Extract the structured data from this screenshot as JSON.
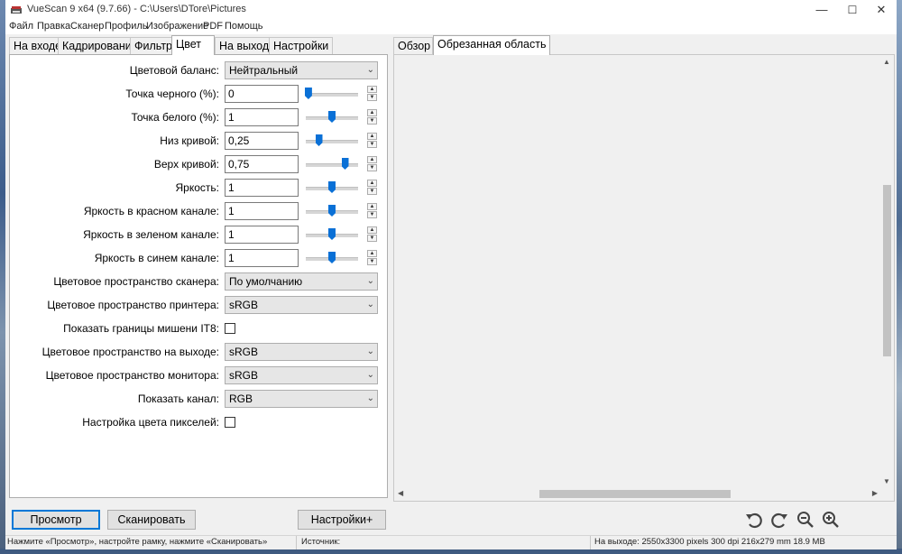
{
  "window": {
    "title": "VueScan 9 x64 (9.7.66) - C:\\Users\\DTore\\Pictures",
    "minimize_glyph": "—",
    "maximize_glyph": "☐",
    "close_glyph": "✕"
  },
  "menu": [
    "Файл",
    "Правка",
    "Сканер",
    "Профиль",
    "Изображение",
    "PDF",
    "Помощь"
  ],
  "left_tabs": {
    "items": [
      "На входе",
      "Кадрирование",
      "Фильтр",
      "Цвет",
      "На выходе",
      "Настройки"
    ],
    "active": "Цвет"
  },
  "color_settings": {
    "color_balance": {
      "label": "Цветовой баланс:",
      "value": "Нейтральный"
    },
    "black_point": {
      "label": "Точка черного (%):",
      "value": "0",
      "slider_pct": 0.05
    },
    "white_point": {
      "label": "Точка белого (%):",
      "value": "1",
      "slider_pct": 0.5
    },
    "curve_low": {
      "label": "Низ кривой:",
      "value": "0,25",
      "slider_pct": 0.25
    },
    "curve_high": {
      "label": "Верх кривой:",
      "value": "0,75",
      "slider_pct": 0.75
    },
    "brightness": {
      "label": "Яркость:",
      "value": "1",
      "slider_pct": 0.5
    },
    "brightness_red": {
      "label": "Яркость в красном канале:",
      "value": "1",
      "slider_pct": 0.5
    },
    "brightness_green": {
      "label": "Яркость в зеленом канале:",
      "value": "1",
      "slider_pct": 0.5
    },
    "brightness_blue": {
      "label": "Яркость в синем канале:",
      "value": "1",
      "slider_pct": 0.5
    },
    "scanner_color_space": {
      "label": "Цветовое пространство сканера:",
      "value": "По умолчанию"
    },
    "printer_color_space": {
      "label": "Цветовое пространство принтера:",
      "value": "sRGB"
    },
    "show_it8_bounds": {
      "label": "Показать границы мишени IT8:",
      "checked": false
    },
    "output_color_space": {
      "label": "Цветовое пространство на выходе:",
      "value": "sRGB"
    },
    "monitor_color_space": {
      "label": "Цветовое пространство монитора:",
      "value": "sRGB"
    },
    "show_channel": {
      "label": "Показать канал:",
      "value": "RGB"
    },
    "pixel_color_setup": {
      "label": "Настройка цвета пикселей:",
      "checked": false
    }
  },
  "right_tabs": {
    "items": [
      "Обзор",
      "Обрезанная область"
    ],
    "active": "Обрезанная область"
  },
  "buttons": {
    "preview": "Просмотр",
    "scan": "Сканировать",
    "settings": "Настройки+"
  },
  "toolbar_icons": [
    "rotate-left-icon",
    "rotate-right-icon",
    "zoom-out-icon",
    "zoom-in-icon"
  ],
  "status": {
    "hint": "Нажмите «Просмотр», настройте рамку, нажмите «Сканировать»",
    "source": "Источник:",
    "output": "На выходе: 2550x3300 pixels 300 dpi 216x279 mm 18.9 MB"
  },
  "colors": {
    "accent": "#0078d7",
    "slider_thumb": "#0a70d6"
  }
}
